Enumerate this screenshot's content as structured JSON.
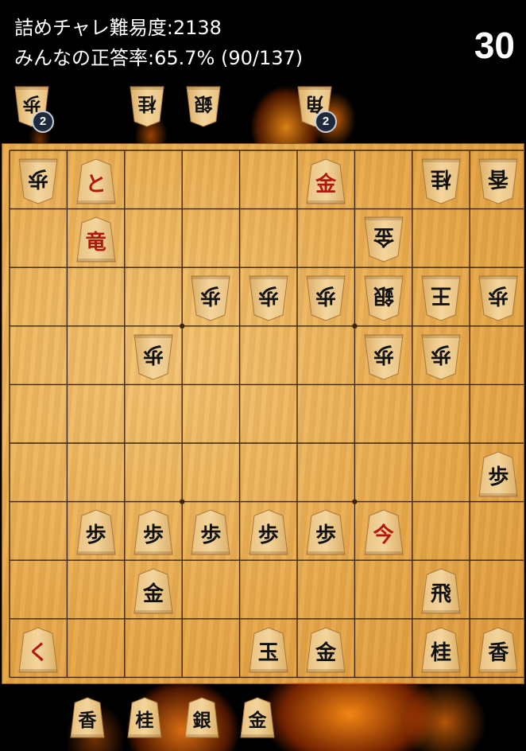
{
  "header": {
    "difficulty_text": "詰めチャレ難易度:2138",
    "correct_rate_text": "みんなの正答率:65.7% (90/137)",
    "counter": "30"
  },
  "opponent_hand": [
    {
      "piece": "歩",
      "count": "2"
    },
    {
      "piece": "桂",
      "count": ""
    },
    {
      "piece": "銀",
      "count": ""
    },
    {
      "piece": "角",
      "count": "2"
    }
  ],
  "player_hand": [
    {
      "piece": "香"
    },
    {
      "piece": "桂"
    },
    {
      "piece": "銀"
    },
    {
      "piece": "金"
    }
  ],
  "board": {
    "files": 9,
    "ranks": 9,
    "pieces": [
      {
        "file": 9,
        "rank": 1,
        "piece": "歩",
        "owner": "gote",
        "promoted": false
      },
      {
        "file": 8,
        "rank": 1,
        "piece": "と",
        "owner": "sente",
        "promoted": true
      },
      {
        "file": 4,
        "rank": 1,
        "piece": "金",
        "owner": "sente",
        "promoted": false,
        "red": true
      },
      {
        "file": 2,
        "rank": 1,
        "piece": "桂",
        "owner": "gote",
        "promoted": false
      },
      {
        "file": 1,
        "rank": 1,
        "piece": "香",
        "owner": "gote",
        "promoted": false
      },
      {
        "file": 8,
        "rank": 2,
        "piece": "竜",
        "owner": "sente",
        "promoted": true
      },
      {
        "file": 3,
        "rank": 2,
        "piece": "金",
        "owner": "gote",
        "promoted": false
      },
      {
        "file": 6,
        "rank": 3,
        "piece": "歩",
        "owner": "gote",
        "promoted": false
      },
      {
        "file": 5,
        "rank": 3,
        "piece": "歩",
        "owner": "gote",
        "promoted": false
      },
      {
        "file": 4,
        "rank": 3,
        "piece": "歩",
        "owner": "gote",
        "promoted": false
      },
      {
        "file": 3,
        "rank": 3,
        "piece": "銀",
        "owner": "gote",
        "promoted": false
      },
      {
        "file": 2,
        "rank": 3,
        "piece": "王",
        "owner": "gote",
        "promoted": false
      },
      {
        "file": 1,
        "rank": 3,
        "piece": "歩",
        "owner": "gote",
        "promoted": false
      },
      {
        "file": 7,
        "rank": 4,
        "piece": "歩",
        "owner": "gote",
        "promoted": false
      },
      {
        "file": 3,
        "rank": 4,
        "piece": "歩",
        "owner": "gote",
        "promoted": false
      },
      {
        "file": 2,
        "rank": 4,
        "piece": "歩",
        "owner": "gote",
        "promoted": false
      },
      {
        "file": 1,
        "rank": 6,
        "piece": "歩",
        "owner": "sente",
        "promoted": false
      },
      {
        "file": 8,
        "rank": 7,
        "piece": "歩",
        "owner": "sente",
        "promoted": false
      },
      {
        "file": 7,
        "rank": 7,
        "piece": "歩",
        "owner": "sente",
        "promoted": false
      },
      {
        "file": 6,
        "rank": 7,
        "piece": "歩",
        "owner": "sente",
        "promoted": false
      },
      {
        "file": 5,
        "rank": 7,
        "piece": "歩",
        "owner": "sente",
        "promoted": false
      },
      {
        "file": 4,
        "rank": 7,
        "piece": "歩",
        "owner": "sente",
        "promoted": false
      },
      {
        "file": 3,
        "rank": 7,
        "piece": "今",
        "owner": "sente",
        "promoted": true
      },
      {
        "file": 7,
        "rank": 8,
        "piece": "金",
        "owner": "sente",
        "promoted": false
      },
      {
        "file": 2,
        "rank": 8,
        "piece": "飛",
        "owner": "sente",
        "promoted": false
      },
      {
        "file": 9,
        "rank": 9,
        "piece": "く",
        "owner": "sente",
        "promoted": true
      },
      {
        "file": 5,
        "rank": 9,
        "piece": "玉",
        "owner": "sente",
        "promoted": false
      },
      {
        "file": 4,
        "rank": 9,
        "piece": "金",
        "owner": "sente",
        "promoted": false
      },
      {
        "file": 2,
        "rank": 9,
        "piece": "桂",
        "owner": "sente",
        "promoted": false
      },
      {
        "file": 1,
        "rank": 9,
        "piece": "香",
        "owner": "sente",
        "promoted": false
      }
    ]
  },
  "colors": {
    "board_wood": "#e7a94c",
    "grid_line": "#3a2408",
    "piece_face": "#f3d59c",
    "promoted_text": "#b3160f",
    "badge": "#1e2a3c"
  }
}
